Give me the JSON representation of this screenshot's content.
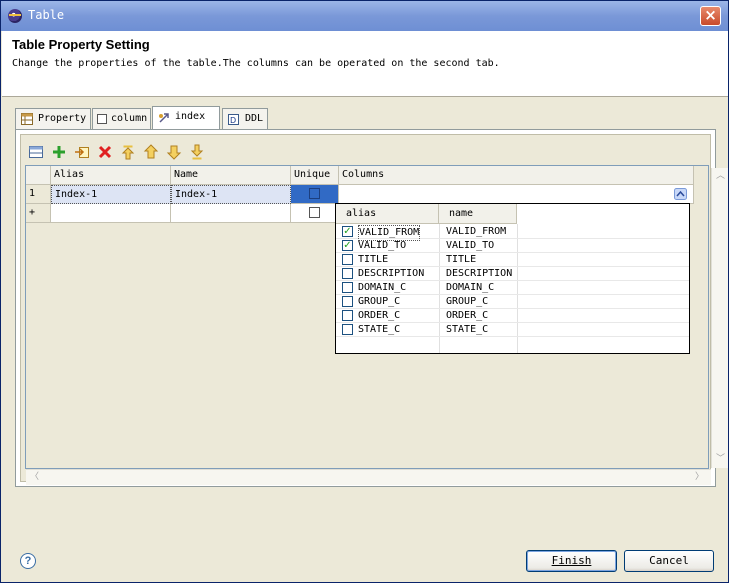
{
  "window": {
    "title": "Table",
    "close_label": "×"
  },
  "header": {
    "title": "Table Property Setting",
    "description": "Change the properties of the table.The columns can be operated on the second tab."
  },
  "tabs": [
    {
      "label": "Property",
      "icon": "table-icon"
    },
    {
      "label": "column",
      "icon": "checkbox-icon"
    },
    {
      "label": "index",
      "icon": "index-icon",
      "active": true
    },
    {
      "label": "DDL",
      "icon": "ddl-icon"
    }
  ],
  "toolbar": [
    "table-view-icon",
    "add-icon",
    "import-icon",
    "delete-icon",
    "move-top-icon",
    "move-up-icon",
    "move-down-icon",
    "move-bottom-icon"
  ],
  "grid": {
    "columns": [
      "Alias",
      "Name",
      "Unique",
      "Columns"
    ],
    "rows": [
      {
        "num": "1",
        "alias": "Index-1",
        "name": "Index-1",
        "unique": false
      },
      {
        "num": "+",
        "alias": "",
        "name": "",
        "unique": false
      }
    ]
  },
  "column_picker": {
    "headers": [
      "alias",
      "name"
    ],
    "items": [
      {
        "alias": "VALID_FROM",
        "name": "VALID_FROM",
        "checked": true
      },
      {
        "alias": "VALID_TO",
        "name": "VALID_TO",
        "checked": true
      },
      {
        "alias": "TITLE",
        "name": "TITLE",
        "checked": false
      },
      {
        "alias": "DESCRIPTION",
        "name": "DESCRIPTION",
        "checked": false
      },
      {
        "alias": "DOMAIN_C",
        "name": "DOMAIN_C",
        "checked": false
      },
      {
        "alias": "GROUP_C",
        "name": "GROUP_C",
        "checked": false
      },
      {
        "alias": "ORDER_C",
        "name": "ORDER_C",
        "checked": false
      },
      {
        "alias": "STATE_C",
        "name": "STATE_C",
        "checked": false
      }
    ]
  },
  "footer": {
    "help": "?",
    "finish_label": "Finish",
    "cancel_label": "Cancel"
  },
  "colors": {
    "title_bar": "#7a98d8",
    "selection": "#316ac5",
    "check": "#21a121"
  }
}
